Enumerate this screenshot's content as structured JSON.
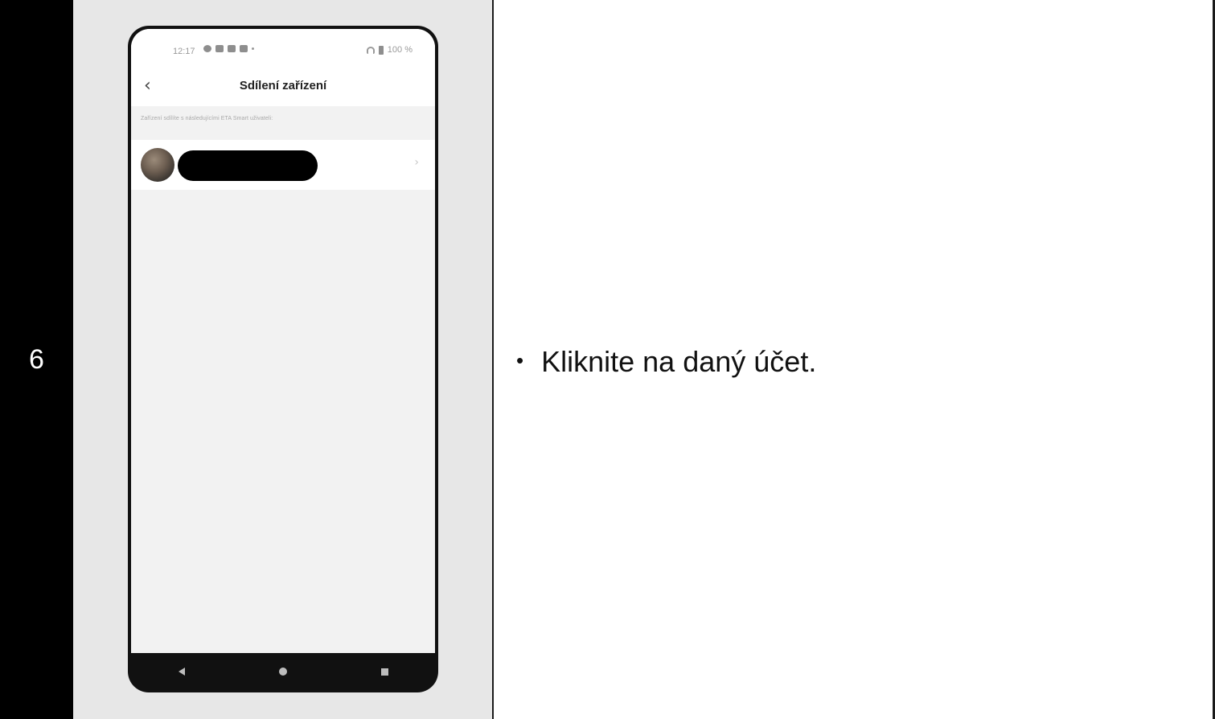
{
  "step": {
    "number": "6"
  },
  "instruction": {
    "bullet": "•",
    "text": "Kliknite na daný účet."
  },
  "phone": {
    "status_bar": {
      "time": "12:17",
      "battery": "100 %"
    },
    "header": {
      "back_icon": "chevron-left-icon",
      "title": "Sdílení zařízení"
    },
    "section_note": "Zařízení sdílíte s následujícími ETA Smart uživateli:",
    "user_list": [
      {
        "name": "",
        "name_redacted": true,
        "avatar": "user-avatar",
        "chevron_icon": "chevron-right-icon"
      }
    ],
    "nav_bar": {
      "buttons": [
        "back",
        "home",
        "recent-apps"
      ]
    }
  },
  "colors": {
    "step_column": "#000000",
    "image_column": "#e7e7e7",
    "screen_background": "#f2f2f2",
    "text": "#111111"
  }
}
